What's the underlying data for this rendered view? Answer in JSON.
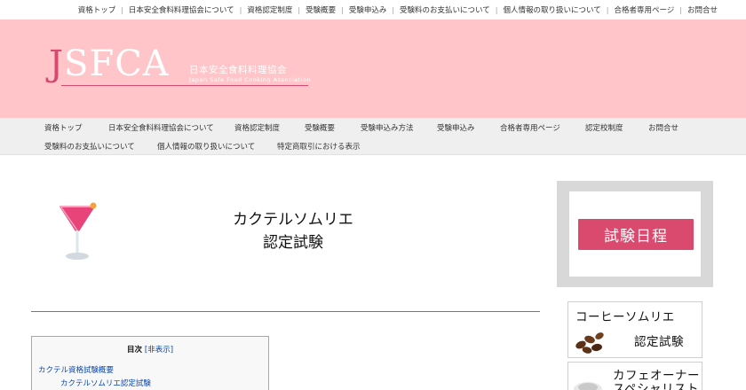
{
  "top_links": [
    "資格トップ",
    "日本安全食料料理協会について",
    "資格認定制度",
    "受験概要",
    "受験申込み",
    "受験料のお支払いについて",
    "個人情報の取り扱いについて",
    "合格者専用ページ",
    "お問合せ"
  ],
  "logo": {
    "mark_j": "J",
    "mark_rest": "SFCA",
    "name_jp": "日本安全食料料理協会",
    "name_en": "Japan Safe Food Cooking Association"
  },
  "nav": {
    "row1": [
      "資格トップ",
      "日本安全食料料理協会について",
      "資格認定制度",
      "受験概要",
      "受験申込み方法",
      "受験申込み",
      "合格者専用ページ",
      "認定校制度",
      "お問合せ"
    ],
    "row2": [
      "受験料のお支払いについて",
      "個人情報の取り扱いについて",
      "特定商取引における表示"
    ]
  },
  "page": {
    "title_line1": "カクテルソムリエ",
    "title_line2": "認定試験"
  },
  "toc": {
    "heading": "目次",
    "toggle": "[非表示]",
    "item1": "カクテル資格試験概要",
    "item1_1": "カクテルソムリエ認定試験"
  },
  "sidebar": {
    "schedule_button": "試験日程",
    "coffee_line1": "コーヒーソムリエ",
    "coffee_line2": "認定試験",
    "cafe_line1": "カフェオーナー",
    "cafe_line2": "スペシャリスト"
  },
  "colors": {
    "header_bg": "#ffc5c9",
    "accent": "#d94a6e",
    "nav_bg": "#efefef",
    "link": "#0645ad"
  }
}
